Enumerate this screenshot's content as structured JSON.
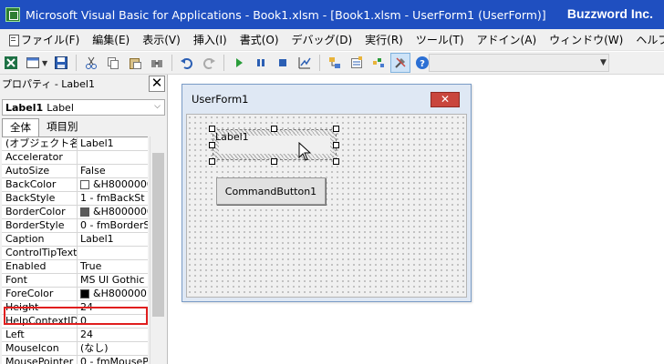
{
  "window": {
    "title": "Microsoft Visual Basic for Applications - Book1.xlsm - [Book1.xlsm - UserForm1 (UserForm)]",
    "brand": "Buzzword Inc."
  },
  "menu": {
    "items": [
      {
        "label": "ファイル(F)"
      },
      {
        "label": "編集(E)"
      },
      {
        "label": "表示(V)"
      },
      {
        "label": "挿入(I)"
      },
      {
        "label": "書式(O)"
      },
      {
        "label": "デバッグ(D)"
      },
      {
        "label": "実行(R)"
      },
      {
        "label": "ツール(T)"
      },
      {
        "label": "アドイン(A)"
      },
      {
        "label": "ウィンドウ(W)"
      },
      {
        "label": "ヘルプ(H)"
      }
    ]
  },
  "toolbar": {
    "icons": [
      "excel-icon",
      "insert-userform-icon",
      "save-icon",
      "cut-icon",
      "copy-icon",
      "paste-icon",
      "find-icon",
      "undo-icon",
      "redo-icon",
      "run-icon",
      "break-icon",
      "reset-icon",
      "design-mode-icon",
      "project-explorer-icon",
      "properties-icon",
      "object-browser-icon",
      "toolbox-icon",
      "help-icon"
    ]
  },
  "properties": {
    "title": "プロパティ - Label1",
    "object_name": "Label1",
    "object_type": "Label",
    "tabs": {
      "all": "全体",
      "category": "項目別"
    },
    "rows": [
      {
        "name": "(オブジェクト名)",
        "value": "Label1"
      },
      {
        "name": "Accelerator",
        "value": ""
      },
      {
        "name": "AutoSize",
        "value": "False"
      },
      {
        "name": "BackColor",
        "value": "&H8000000",
        "swatch": "#ffffff"
      },
      {
        "name": "BackStyle",
        "value": "1 - fmBackSt"
      },
      {
        "name": "BorderColor",
        "value": "&H8000000",
        "swatch": "#5a5a5a"
      },
      {
        "name": "BorderStyle",
        "value": "0 - fmBorderS"
      },
      {
        "name": "Caption",
        "value": "Label1"
      },
      {
        "name": "ControlTipText",
        "value": ""
      },
      {
        "name": "Enabled",
        "value": "True"
      },
      {
        "name": "Font",
        "value": "MS UI Gothic"
      },
      {
        "name": "ForeColor",
        "value": "&H8000001",
        "swatch": "#000000"
      },
      {
        "name": "Height",
        "value": "24"
      },
      {
        "name": "HelpContextID",
        "value": "0"
      },
      {
        "name": "Left",
        "value": "24"
      },
      {
        "name": "MouseIcon",
        "value": "(なし)"
      },
      {
        "name": "MousePointer",
        "value": "0 - fmMouseP"
      }
    ]
  },
  "userform": {
    "title": "UserForm1",
    "label_caption": "Label1",
    "button_caption": "CommandButton1"
  },
  "colors": {
    "titlebar": "#1f4fc0",
    "highlight": "#e01e1e",
    "form_close": "#c9463d"
  }
}
